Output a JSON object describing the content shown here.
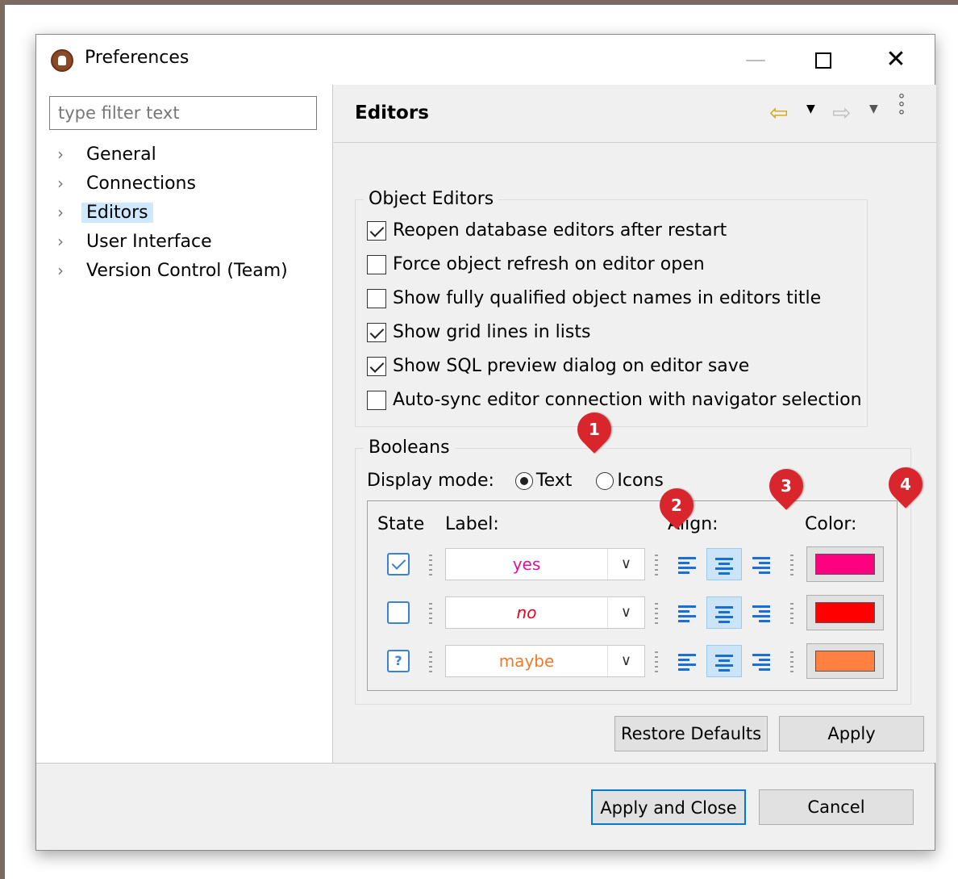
{
  "window": {
    "title": "Preferences",
    "minimize_label": "—",
    "close_label": "✕"
  },
  "filter": {
    "placeholder": "type filter text",
    "value": ""
  },
  "tree": {
    "items": [
      {
        "label": "General",
        "selected": false
      },
      {
        "label": "Connections",
        "selected": false
      },
      {
        "label": "Editors",
        "selected": true
      },
      {
        "label": "User Interface",
        "selected": false
      },
      {
        "label": "Version Control (Team)",
        "selected": false
      }
    ]
  },
  "page": {
    "title": "Editors",
    "nav_back_icon": "arrow-left-icon",
    "nav_forward_icon": "arrow-right-icon",
    "menu_icon": "view-menu-icon"
  },
  "object_editors": {
    "title": "Object Editors",
    "options": [
      {
        "label": "Reopen database editors after restart",
        "checked": true
      },
      {
        "label": "Force object refresh on editor open",
        "checked": false
      },
      {
        "label": "Show fully qualified object names in editors title",
        "checked": false
      },
      {
        "label": "Show grid lines in lists",
        "checked": true
      },
      {
        "label": "Show SQL preview dialog on editor save",
        "checked": true
      },
      {
        "label": "Auto-sync editor connection with navigator selection",
        "checked": false
      }
    ]
  },
  "booleans": {
    "title": "Booleans",
    "display_mode_label": "Display mode:",
    "mode_text": "Text",
    "mode_icons": "Icons",
    "selected_mode": "Text",
    "headers": {
      "state": "State",
      "label": "Label:",
      "align": "Align:",
      "color": "Color:"
    },
    "rows": [
      {
        "state": "checked",
        "label": "yes",
        "style": "normal",
        "text_color": "#e0119a",
        "color": "#ff0080",
        "align": "center"
      },
      {
        "state": "unchecked",
        "label": "no",
        "style": "italic",
        "text_color": "#e8001c",
        "color": "#ff0000",
        "align": "center"
      },
      {
        "state": "unknown",
        "state_glyph": "?",
        "label": "maybe",
        "style": "normal",
        "text_color": "#f07a2c",
        "color": "#ff8040",
        "align": "center"
      }
    ]
  },
  "markers": [
    "1",
    "2",
    "3",
    "4"
  ],
  "buttons": {
    "restore_defaults": "Restore Defaults",
    "apply": "Apply",
    "apply_and_close": "Apply and Close",
    "cancel": "Cancel"
  }
}
